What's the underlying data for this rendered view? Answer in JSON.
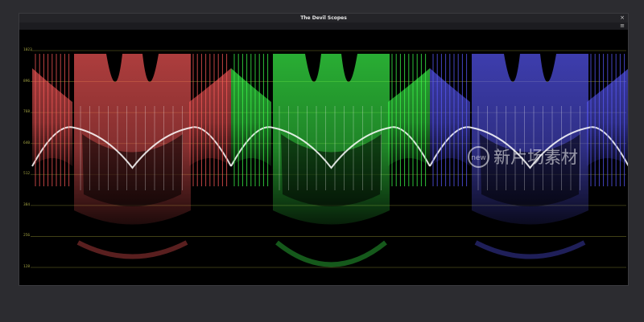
{
  "window": {
    "title": "The Devil Scopes"
  },
  "controls": {
    "close_glyph": "×",
    "menu_glyph": "≡"
  },
  "axis": {
    "labels": [
      "1023",
      "896",
      "768",
      "640",
      "512",
      "384",
      "256",
      "128"
    ]
  },
  "channels": [
    {
      "name": "red",
      "color": "#ff5a5a"
    },
    {
      "name": "green",
      "color": "#3cff4c"
    },
    {
      "name": "blue",
      "color": "#5a5aff"
    }
  ],
  "watermark": {
    "logo_text": "new",
    "text": "新片场素材"
  }
}
